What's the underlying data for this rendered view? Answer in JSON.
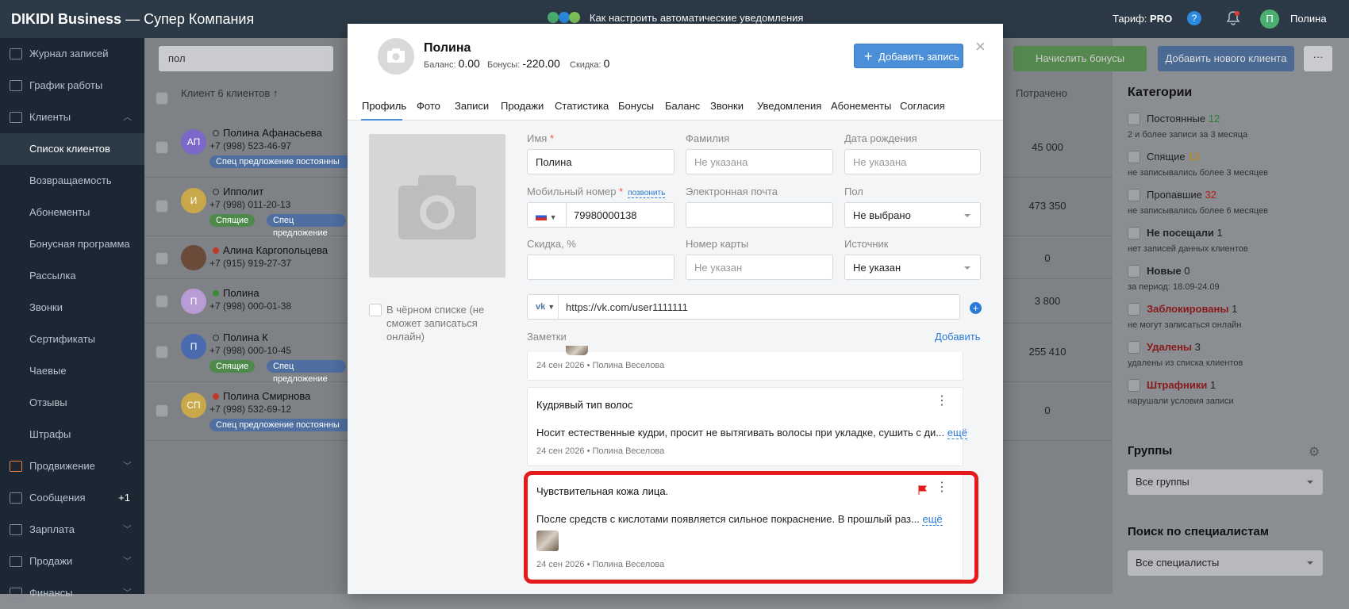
{
  "topbar": {
    "brand": "DIKIDI Business",
    "company": "— Супер Компания",
    "notice": "Как настроить автоматические уведомления",
    "tariff_label": "Тариф:",
    "tariff_value": "PRO",
    "help": "?",
    "user_initial": "П",
    "user_name": "Полина"
  },
  "sidebar": {
    "items": [
      {
        "label": "Журнал записей"
      },
      {
        "label": "График работы"
      },
      {
        "label": "Клиенты"
      },
      {
        "label": "Список клиентов"
      },
      {
        "label": "Возвращаемость"
      },
      {
        "label": "Абонементы"
      },
      {
        "label": "Бонусная программа"
      },
      {
        "label": "Рассылка"
      },
      {
        "label": "Звонки"
      },
      {
        "label": "Сертификаты"
      },
      {
        "label": "Чаевые"
      },
      {
        "label": "Отзывы"
      },
      {
        "label": "Штрафы"
      },
      {
        "label": "Продвижение"
      },
      {
        "label": "Сообщения",
        "count": "+1"
      },
      {
        "label": "Зарплата"
      },
      {
        "label": "Продажи"
      },
      {
        "label": "Финансы"
      }
    ]
  },
  "clients": {
    "search_value": "пол",
    "header_client": "Клиент 6 клиентов ↑",
    "header_spent": "Потрачено",
    "rows": [
      {
        "initials": "АП",
        "color": "#7b68c8",
        "name": "Полина Афанасьева",
        "phone": "+7 (998) 523-46-97",
        "tags": [
          "Спец предложение постоянны"
        ],
        "spent": "45 000"
      },
      {
        "initials": "И",
        "color": "#c9a84a",
        "name": "Ипполит",
        "phone": "+7 (998) 011-20-13",
        "tags": [
          "Спящие",
          "Спец предложение"
        ],
        "spent": "473 350"
      },
      {
        "initials": "",
        "color": "#6b4a3a",
        "name": "Алина Каргопольцева",
        "phone": "+7 (915) 919-27-37",
        "tags": [],
        "spent": "0"
      },
      {
        "initials": "П",
        "color": "#b79cd6",
        "name": "Полина",
        "phone": "+7 (998) 000-01-38",
        "tags": [],
        "spent": "3 800"
      },
      {
        "initials": "П",
        "color": "#4a6ab0",
        "name": "Полина К",
        "phone": "+7 (998) 000-10-45",
        "tags": [
          "Спящие",
          "Спец предложение"
        ],
        "spent": "255 410"
      },
      {
        "initials": "СП",
        "color": "#c9a84a",
        "name": "Полина Смирнова",
        "phone": "+7 (998) 532-69-12",
        "tags": [
          "Спец предложение постоянны"
        ],
        "spent": "0"
      }
    ]
  },
  "actions": {
    "bonus": "Начислить бонусы",
    "add_client": "Добавить нового клиента",
    "more": "···"
  },
  "right": {
    "categories_title": "Категории",
    "categories": [
      {
        "name": "Постоянные",
        "count": "12",
        "color": "#2e7d32",
        "desc": "2 и более записи за 3 месяца"
      },
      {
        "name": "Спящие",
        "count": "13",
        "color": "#c08a00",
        "desc": "не записывались более 3 месяцев"
      },
      {
        "name": "Пропавшие",
        "count": "32",
        "color": "#b71c1c",
        "desc": "не записывались более 6 месяцев"
      },
      {
        "name": "Не посещали",
        "count": "1",
        "color": "#444",
        "desc": "нет записей данных клиентов"
      },
      {
        "name": "Новые",
        "count": "0",
        "color": "#444",
        "desc": "за период: 18.09-24.09"
      },
      {
        "name": "Заблокированы",
        "count": "1",
        "color": "#b71c1c",
        "desc": "не могут записаться онлайн"
      },
      {
        "name": "Удалены",
        "count": "3",
        "color": "#b71c1c",
        "desc": "удалены из списка клиентов"
      },
      {
        "name": "Штрафники",
        "count": "1",
        "color": "#b71c1c",
        "desc": "нарушали условия записи"
      }
    ],
    "groups_title": "Группы",
    "groups_value": "Все группы",
    "spec_title": "Поиск по специалистам",
    "spec_value": "Все специалисты"
  },
  "modal": {
    "name": "Полина",
    "balance_label": "Баланс:",
    "balance": "0.00",
    "bonus_label": "Бонусы:",
    "bonus": "-220.00",
    "discount_label": "Скидка:",
    "discount": "0",
    "add_record": "Добавить запись",
    "tabs": [
      "Профиль",
      "Фото",
      "Записи",
      "Продажи",
      "Статистика",
      "Бонусы",
      "Баланс",
      "Звонки",
      "Уведомления",
      "Абонементы",
      "Согласия"
    ],
    "blacklist": "В чёрном списке (не сможет записаться онлайн)",
    "form": {
      "first_name_label": "Имя",
      "first_name": "Полина",
      "last_name_label": "Фамилия",
      "last_name_ph": "Не указана",
      "birth_label": "Дата рождения",
      "birth_ph": "Не указана",
      "phone_label": "Мобильный номер",
      "call": "позвонить",
      "phone": "79980000138",
      "email_label": "Электронная почта",
      "gender_label": "Пол",
      "gender": "Не выбрано",
      "discount_label": "Скидка, %",
      "card_label": "Номер карты",
      "card_ph": "Не указан",
      "source_label": "Источник",
      "source": "Не указан",
      "vk": "https://vk.com/user1111111"
    },
    "notes_label": "Заметки",
    "notes_add": "Добавить",
    "notes": [
      {
        "title": "",
        "text": "",
        "meta": "24 сен 2026 • Полина Веселова"
      },
      {
        "title": "Кудрявый тип волос",
        "text": "Носит естественные кудри, просит не вытягивать волосы при укладке, сушить с ди...",
        "more": "ещё",
        "meta": "24 сен 2026 • Полина Веселова"
      },
      {
        "title": "Чувствительная кожа лица.",
        "text": "После средств с кислотами появляется сильное покраснение. В прошлый раз...",
        "more": "ещё",
        "meta": "24 сен 2026 • Полина Веселова"
      }
    ]
  }
}
